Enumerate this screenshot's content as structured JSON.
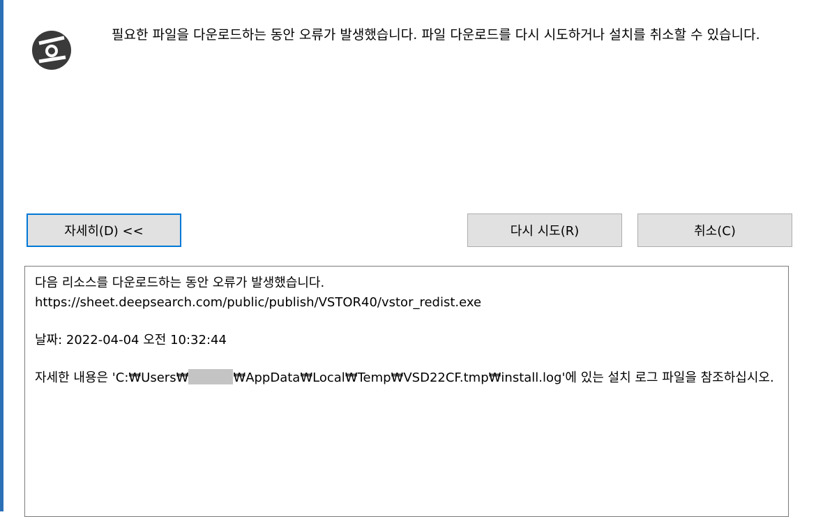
{
  "message": {
    "text": "필요한 파일을 다운로드하는 동안 오류가 발생했습니다. 파일 다운로드를 다시 시도하거나 설치를 취소할 수 있습니다."
  },
  "buttons": {
    "details_label": "자세히(D) <<",
    "retry_label": "다시 시도(R)",
    "cancel_label": "취소(C)"
  },
  "details": {
    "line1": "다음 리소스를 다운로드하는 동안 오류가 발생했습니다.",
    "url": "https://sheet.deepsearch.com/public/publish/VSTOR40/vstor_redist.exe",
    "date": "날짜: 2022-04-04 오전 10:32:44",
    "log_prefix": "자세한 내용은 'C:₩Users₩",
    "log_suffix": "₩AppData₩Local₩Temp₩VSD22CF.tmp₩install.log'에 있는 설치 로그 파일을 참조하십시오."
  },
  "icon": {
    "name": "installer-disc-icon",
    "color": "#333333"
  }
}
